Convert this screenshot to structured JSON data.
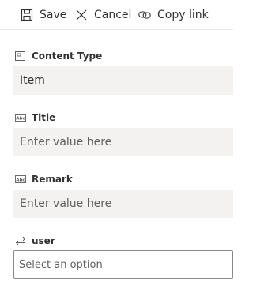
{
  "toolbar": {
    "save_label": "Save",
    "save_icon": "save-icon",
    "cancel_label": "Cancel",
    "cancel_icon": "close-icon",
    "copy_link_label": "Copy link",
    "copy_link_icon": "link-icon"
  },
  "form": {
    "content_type": {
      "label": "Content Type",
      "icon": "content-type-icon",
      "value": "Item"
    },
    "title": {
      "label": "Title",
      "icon": "text-field-icon",
      "placeholder": "Enter value here"
    },
    "remark": {
      "label": "Remark",
      "icon": "text-field-icon",
      "placeholder": "Enter value here"
    },
    "user": {
      "label": "user",
      "icon": "swap-arrows-icon",
      "placeholder": "Select an option"
    }
  },
  "colors": {
    "text": "#323130",
    "placeholder": "#605e5c",
    "field_background": "#f3f2f1",
    "border": "#8a8886"
  }
}
